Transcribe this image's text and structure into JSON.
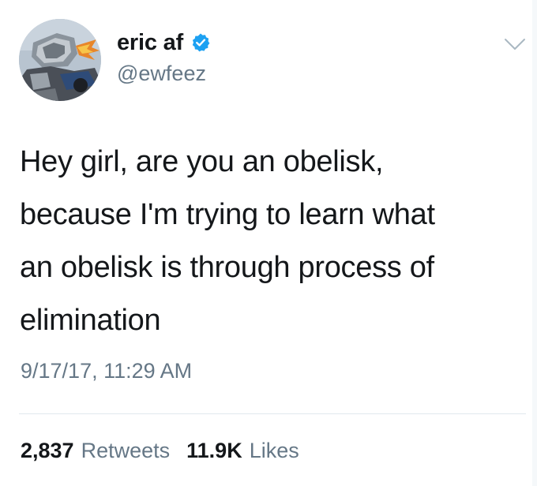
{
  "author": {
    "display_name": "eric af",
    "handle": "@ewfeez",
    "verified": true,
    "avatar_icon": "robot-monster-avatar"
  },
  "tweet": {
    "text_lines": [
      "Hey girl, are you an obelisk,",
      "because I'm trying to learn what",
      "an obelisk is through process of",
      "elimination"
    ],
    "timestamp": "9/17/17, 11:29 AM"
  },
  "stats": {
    "retweets_count": "2,837",
    "retweets_label": "Retweets",
    "likes_count": "11.9K",
    "likes_label": "Likes"
  },
  "icons": {
    "verified": "verified-badge-icon",
    "menu": "chevron-down-icon"
  },
  "colors": {
    "text_primary": "#14171a",
    "text_secondary": "#657786",
    "verified_blue": "#1da1f2",
    "divider": "#e1e8ed"
  }
}
